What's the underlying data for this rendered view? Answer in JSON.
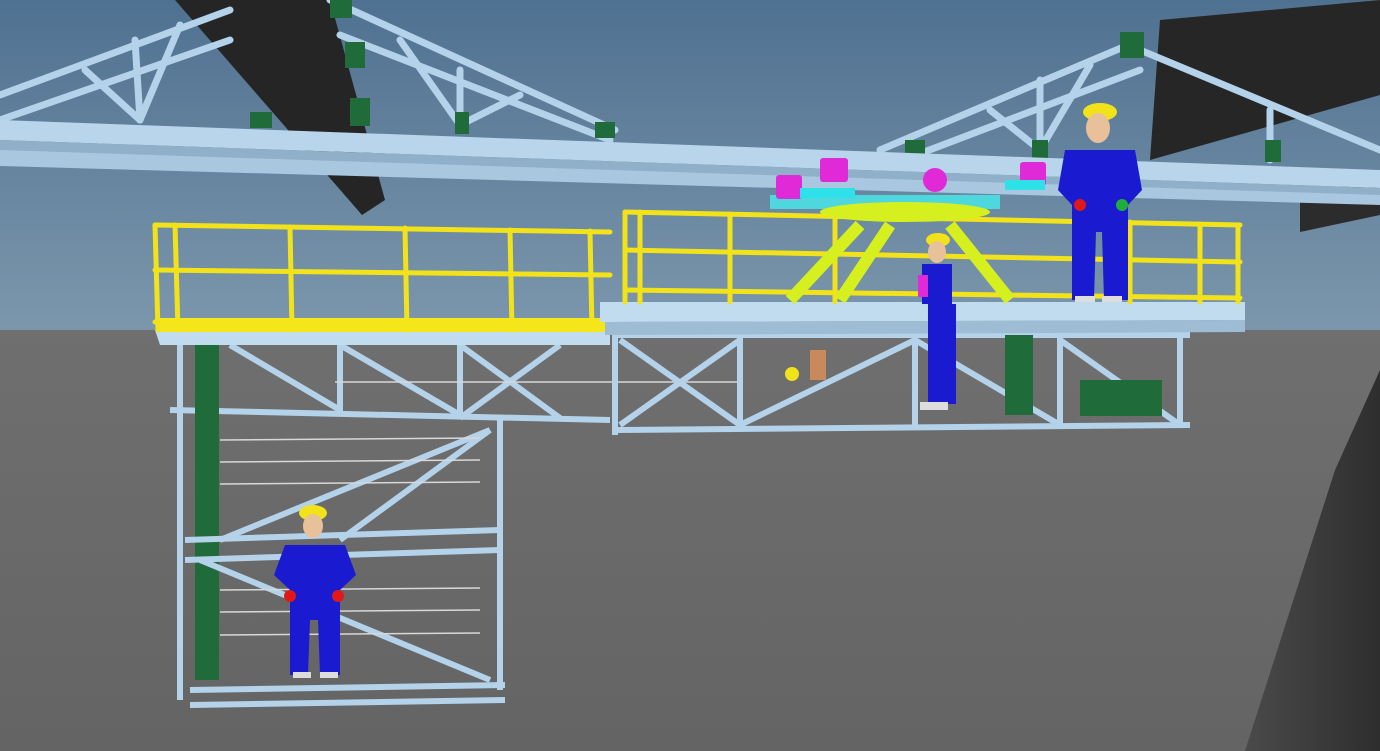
{
  "scene": {
    "description_visible_text": "",
    "colors": {
      "sky": "#5f7f98",
      "floor": "#6b6b6b",
      "steel": "#b6d4ec",
      "steel_dark": "#6f8fa8",
      "railing": "#f2e21a",
      "railing_dark": "#b8a800",
      "column_green": "#1f6b3a",
      "beam_black": "#2a2a2a",
      "worker_suit": "#1a1ad0",
      "worker_helmet": "#f2e21a",
      "worker_glove": "#e01818",
      "fixture_magenta": "#e02ad8",
      "fixture_cyan": "#2ee0e8",
      "gear_lime": "#d6ef1e"
    },
    "workers": [
      {
        "name": "worker-upper-right"
      },
      {
        "name": "worker-middle"
      },
      {
        "name": "worker-lower-cage"
      }
    ]
  }
}
